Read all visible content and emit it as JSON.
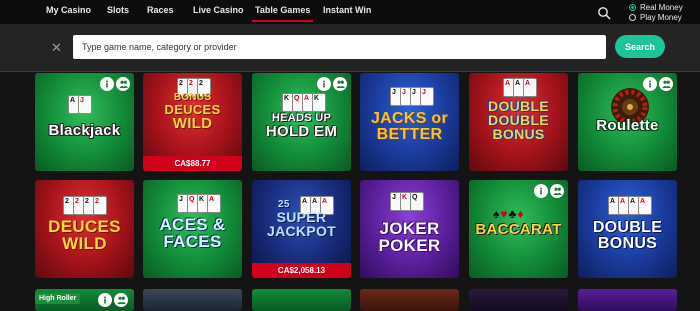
{
  "nav": {
    "items": [
      "My Casino",
      "Slots",
      "Races",
      "Live Casino",
      "Table Games",
      "Instant Win"
    ],
    "active": "Table Games"
  },
  "modes": {
    "real": "Real Money",
    "play": "Play Money",
    "selected": "Real Money"
  },
  "search": {
    "placeholder": "Type game name, category or provider",
    "button": "Search"
  },
  "games": [
    {
      "title_lines": [
        "Blackjack"
      ],
      "has_icons": true,
      "jackpot": null
    },
    {
      "title_lines": [
        "BONUS",
        "DEUCES",
        "WILD"
      ],
      "has_icons": false,
      "jackpot": "CA$88.77"
    },
    {
      "title_lines": [
        "HEADS UP",
        "HOLD EM"
      ],
      "has_icons": true,
      "jackpot": null
    },
    {
      "title_lines": [
        "JACKS or",
        "BETTER"
      ],
      "has_icons": false,
      "jackpot": null
    },
    {
      "title_lines": [
        "DOUBLE",
        "DOUBLE",
        "BONUS"
      ],
      "has_icons": false,
      "jackpot": null
    },
    {
      "title_lines": [
        "Roulette"
      ],
      "has_icons": true,
      "jackpot": null
    },
    {
      "title_lines": [
        "DEUCES",
        "WILD"
      ],
      "has_icons": false,
      "jackpot": null
    },
    {
      "title_lines": [
        "ACES &",
        "FACES"
      ],
      "has_icons": false,
      "jackpot": null
    },
    {
      "title_lines": [
        "25",
        "SUPER",
        "JACKPOT"
      ],
      "has_icons": false,
      "jackpot": "CA$2,058.13"
    },
    {
      "title_lines": [
        "JOKER",
        "POKER"
      ],
      "has_icons": false,
      "jackpot": null
    },
    {
      "title_lines": [
        "BACCARAT"
      ],
      "has_icons": true,
      "jackpot": null
    },
    {
      "title_lines": [
        "DOUBLE",
        "BONUS"
      ],
      "has_icons": false,
      "jackpot": null
    }
  ],
  "badges": {
    "high_roller": "High Roller"
  },
  "colors": {
    "accent": "#1ec497",
    "jackpot_bar": "#d0021b",
    "nav_active": "#d0021b"
  },
  "icons": {
    "top_search": "search-icon",
    "clear": "close-icon",
    "tile_info": "info-icon",
    "tile_multiplayer": "users-icon"
  }
}
